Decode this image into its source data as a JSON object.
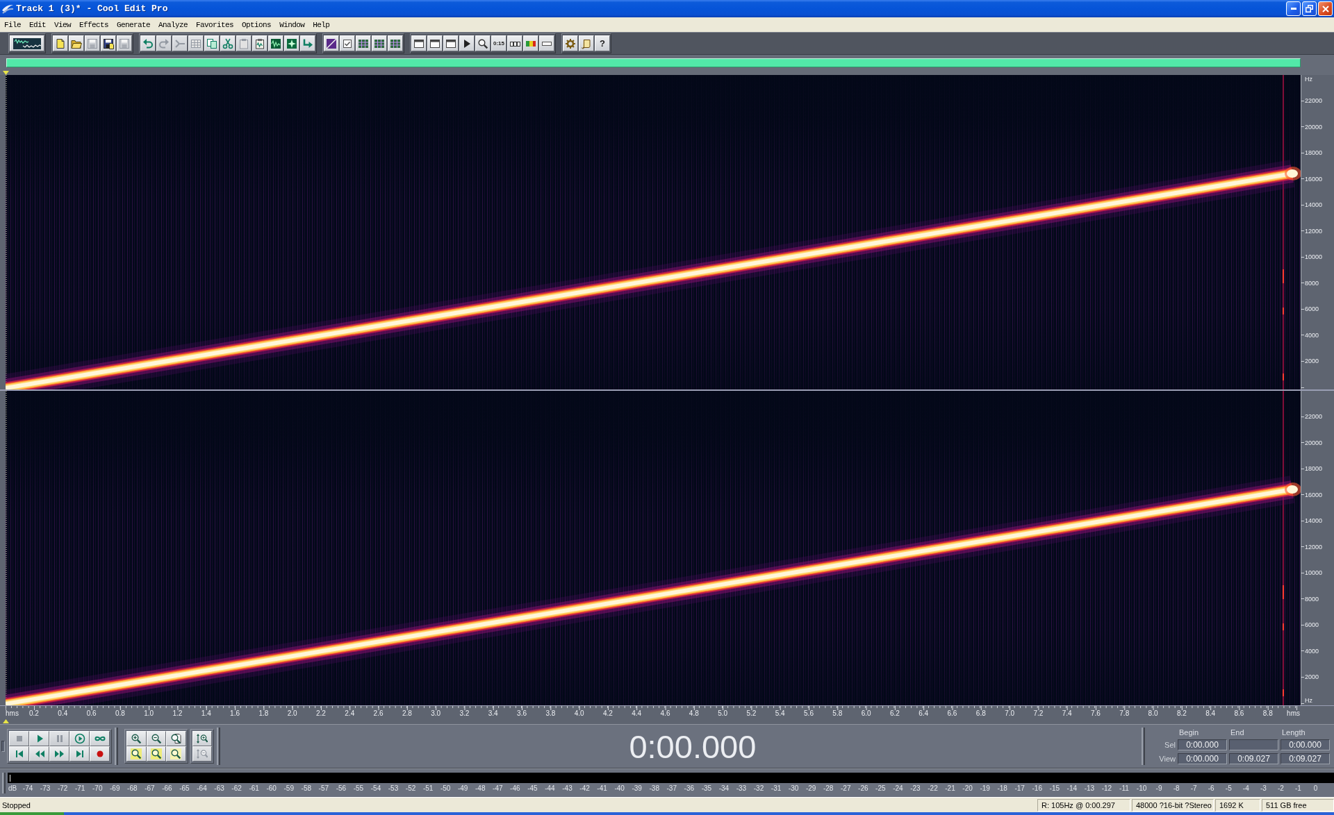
{
  "window": {
    "title": "Track 1 (3)* - Cool Edit Pro"
  },
  "menu": [
    "File",
    "Edit",
    "View",
    "Effects",
    "Generate",
    "Analyze",
    "Favorites",
    "Options",
    "Window",
    "Help"
  ],
  "toolbar": [
    [
      {
        "kind": "multitrack",
        "disabled": false
      }
    ],
    [
      {
        "kind": "new",
        "disabled": false
      },
      {
        "kind": "open",
        "disabled": false
      },
      {
        "kind": "save",
        "disabled": true
      },
      {
        "kind": "saveas",
        "disabled": false
      },
      {
        "kind": "savesel",
        "disabled": true
      }
    ],
    [
      {
        "kind": "undo",
        "disabled": false
      },
      {
        "kind": "redo",
        "disabled": true
      },
      {
        "kind": "repeat",
        "disabled": true
      },
      {
        "kind": "grid",
        "disabled": true
      },
      {
        "kind": "copy",
        "disabled": false
      },
      {
        "kind": "cut",
        "disabled": false
      },
      {
        "kind": "paste",
        "disabled": true
      },
      {
        "kind": "mixpaste",
        "disabled": false
      },
      {
        "kind": "trim",
        "disabled": false
      },
      {
        "kind": "insert",
        "disabled": false
      },
      {
        "kind": "convert",
        "disabled": false
      }
    ],
    [
      {
        "kind": "spectral",
        "disabled": false
      },
      {
        "kind": "check",
        "disabled": false
      },
      {
        "kind": "tracks",
        "disabled": false
      },
      {
        "kind": "tracks",
        "disabled": false
      },
      {
        "kind": "tracks",
        "disabled": false
      }
    ],
    [
      {
        "kind": "panel",
        "disabled": false
      },
      {
        "kind": "panel",
        "disabled": false
      },
      {
        "kind": "panel",
        "disabled": false
      },
      {
        "kind": "cue",
        "disabled": false
      },
      {
        "kind": "zoom",
        "disabled": false
      },
      {
        "kind": "time",
        "label": "0:15",
        "disabled": false
      },
      {
        "kind": "boxes",
        "disabled": false
      },
      {
        "kind": "meters",
        "disabled": false
      },
      {
        "kind": "statusbar",
        "disabled": false
      }
    ],
    [
      {
        "kind": "settings",
        "disabled": false
      },
      {
        "kind": "scroll",
        "disabled": false
      },
      {
        "kind": "help",
        "label": "?",
        "disabled": false
      }
    ]
  ],
  "spectrogram": {
    "channels": [
      {
        "unit_top": "Hz",
        "labels": [
          "22000",
          "20000",
          "18000",
          "16000",
          "14000",
          "12000",
          "10000",
          "8000",
          "6000",
          "4000",
          "2000"
        ]
      },
      {
        "labels": [
          "22000",
          "20000",
          "18000",
          "16000",
          "14000",
          "12000",
          "10000",
          "8000",
          "6000",
          "4000",
          "2000"
        ],
        "unit_bottom": "Hz"
      }
    ]
  },
  "time_axis": {
    "unit_left": "hms",
    "labels": [
      "0.2",
      "0.4",
      "0.6",
      "0.8",
      "1.0",
      "1.2",
      "1.4",
      "1.6",
      "1.8",
      "2.0",
      "2.2",
      "2.4",
      "2.6",
      "2.8",
      "3.0",
      "3.2",
      "3.4",
      "3.6",
      "3.8",
      "4.0",
      "4.2",
      "4.4",
      "4.6",
      "4.8",
      "5.0",
      "5.2",
      "5.4",
      "5.6",
      "5.8",
      "6.0",
      "6.2",
      "6.4",
      "6.6",
      "6.8",
      "7.0",
      "7.2",
      "7.4",
      "7.6",
      "7.8",
      "8.0",
      "8.2",
      "8.4",
      "8.6",
      "8.8"
    ],
    "unit_right": "hms"
  },
  "transport": [
    [
      {
        "kind": "stop",
        "disabled": true
      },
      {
        "kind": "play",
        "disabled": false
      },
      {
        "kind": "pause",
        "disabled": true
      },
      {
        "kind": "playtoend",
        "disabled": false
      },
      {
        "kind": "loop",
        "disabled": false
      }
    ],
    [
      {
        "kind": "tostart",
        "disabled": false
      },
      {
        "kind": "rewind",
        "disabled": false
      },
      {
        "kind": "forward",
        "disabled": false
      },
      {
        "kind": "toend",
        "disabled": false
      },
      {
        "kind": "record",
        "disabled": false
      }
    ]
  ],
  "zoom": [
    [
      {
        "kind": "zoomin",
        "disabled": false
      },
      {
        "kind": "zoomout",
        "disabled": false
      },
      {
        "kind": "zoomfull",
        "disabled": false
      }
    ],
    [
      {
        "kind": "zoomleft",
        "disabled": false
      },
      {
        "kind": "zoomright",
        "disabled": false
      },
      {
        "kind": "zoomsel",
        "disabled": false
      }
    ]
  ],
  "vertical_zoom": [
    [
      {
        "kind": "vzoomin",
        "disabled": false
      }
    ],
    [
      {
        "kind": "vzoomout",
        "disabled": true
      }
    ]
  ],
  "time_display": "0:00.000",
  "selection": {
    "headers": {
      "begin": "Begin",
      "end": "End",
      "length": "Length"
    },
    "rows": [
      {
        "label": "Sel",
        "begin": "0:00.000",
        "length": "0:00.000"
      },
      {
        "label": "View",
        "begin": "0:00.000",
        "end": "0:09.027",
        "length": "0:09.027"
      }
    ]
  },
  "level_meter": {
    "unit": "dB",
    "labels": [
      "-74",
      "-73",
      "-72",
      "-71",
      "-70",
      "-69",
      "-68",
      "-67",
      "-66",
      "-65",
      "-64",
      "-63",
      "-62",
      "-61",
      "-60",
      "-59",
      "-58",
      "-57",
      "-56",
      "-55",
      "-54",
      "-53",
      "-52",
      "-51",
      "-50",
      "-49",
      "-48",
      "-47",
      "-46",
      "-45",
      "-44",
      "-43",
      "-42",
      "-41",
      "-40",
      "-39",
      "-38",
      "-37",
      "-36",
      "-35",
      "-34",
      "-33",
      "-32",
      "-31",
      "-30",
      "-29",
      "-28",
      "-27",
      "-26",
      "-25",
      "-24",
      "-23",
      "-22",
      "-21",
      "-20",
      "-19",
      "-18",
      "-17",
      "-16",
      "-15",
      "-14",
      "-13",
      "-12",
      "-11",
      "-10",
      "-9",
      "-8",
      "-7",
      "-6",
      "-5",
      "-4",
      "-3",
      "-2",
      "-1",
      "0"
    ]
  },
  "status_bar": {
    "state": "Stopped",
    "cursor": "R: 105Hz @ 0:00.297",
    "format": "48000 ?16-bit ?Stereo",
    "size": "1692 K",
    "free": "511 GB free"
  }
}
